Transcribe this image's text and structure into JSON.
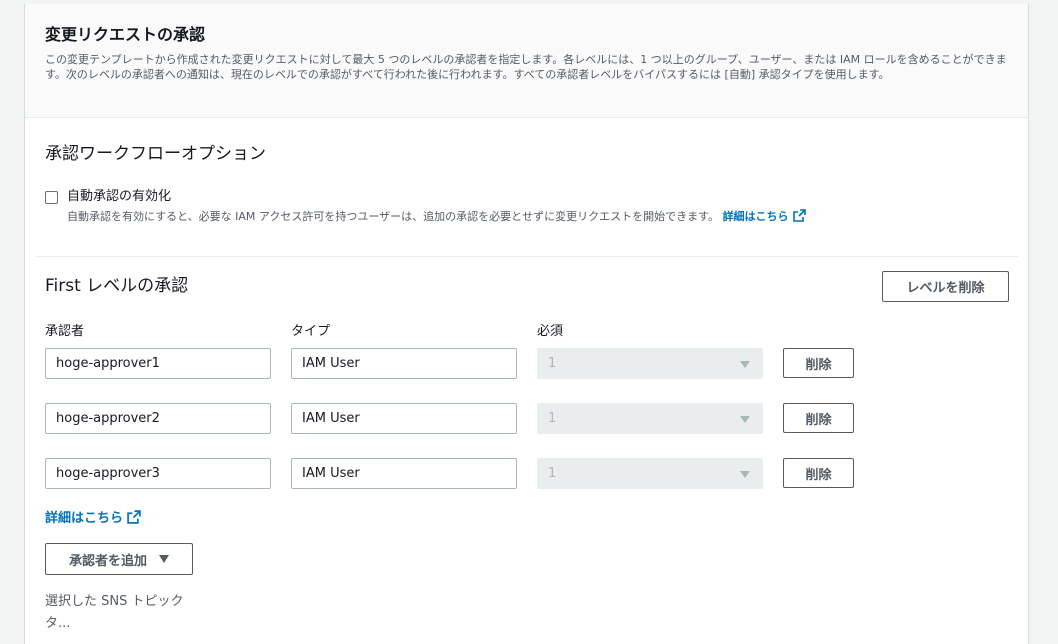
{
  "header": {
    "title": "変更リクエストの承認",
    "description": "この変更テンプレートから作成された変更リクエストに対して最大 5 つのレベルの承認者を指定します。各レベルには、1 つ以上のグループ、ユーザー、または IAM ロールを含めることができます。次のレベルの承認者への通知は、現在のレベルでの承認がすべて行われた後に行われます。すべての承認者レベルをバイパスするには [自動] 承認タイプを使用します。"
  },
  "workflow": {
    "title": "承認ワークフローオプション",
    "auto_approval_label": "自動承認の有効化",
    "auto_approval_checked": false,
    "auto_approval_desc": "自動承認を有効にすると、必要な IAM アクセス許可を持つユーザーは、追加の承認を必要とせずに変更リクエストを開始できます。",
    "learn_more": "詳細はこちら"
  },
  "level": {
    "title": "First レベルの承認",
    "delete_level_label": "レベルを削除",
    "columns": {
      "approver": "承認者",
      "type": "タイプ",
      "required": "必須"
    },
    "approvers": [
      {
        "name": "hoge-approver1",
        "type": "IAM User",
        "required": "1",
        "remove_label": "削除"
      },
      {
        "name": "hoge-approver2",
        "type": "IAM User",
        "required": "1",
        "remove_label": "削除"
      },
      {
        "name": "hoge-approver3",
        "type": "IAM User",
        "required": "1",
        "remove_label": "削除"
      }
    ],
    "learn_more": "詳細はこちら",
    "add_approver_label": "承認者を追加",
    "sns_label": "選択した SNS トピック",
    "sns_label_cont": "タ..."
  },
  "colors": {
    "link": "#0073bb",
    "border": "#aab7b8",
    "disabled_bg": "#eaeded"
  },
  "icons": {
    "external_link": "external-link-icon",
    "dropdown": "caret-down-icon"
  }
}
